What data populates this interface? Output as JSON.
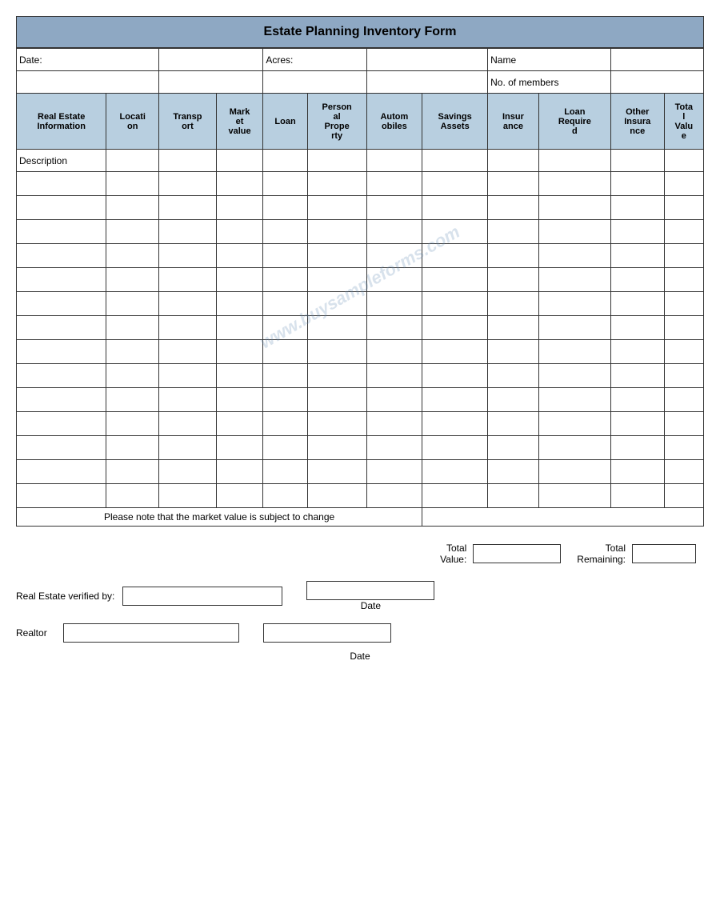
{
  "title": "Estate Planning Inventory Form",
  "topInfo": {
    "dateLabel": "Date:",
    "acresLabel": "Acres:",
    "nameLabel": "Name",
    "noOfMembersLabel": "No. of members"
  },
  "columns": [
    {
      "id": "real-estate",
      "label": "Real Estate\nInformation"
    },
    {
      "id": "location",
      "label": "Locati\non"
    },
    {
      "id": "transport",
      "label": "Transp\nort"
    },
    {
      "id": "market-value",
      "label": "Mark\net\nvalue"
    },
    {
      "id": "loan",
      "label": "Loan"
    },
    {
      "id": "personal-property",
      "label": "Person\nal\nPrope\nrty"
    },
    {
      "id": "automobiles",
      "label": "Autom\nobiles"
    },
    {
      "id": "savings-assets",
      "label": "Savings\nAssets"
    },
    {
      "id": "insurance",
      "label": "Insur\nance"
    },
    {
      "id": "loan-required",
      "label": "Loan\nRequire\nd"
    },
    {
      "id": "other-insurance",
      "label": "Other\nInsura\nnce"
    },
    {
      "id": "total-value",
      "label": "Tota\nl\nValu\ne"
    }
  ],
  "descriptionLabel": "Description",
  "dataRows": 14,
  "notice": "Please note that the market value is subject to change",
  "watermark": "www.buysampleforms.com",
  "bottomSection": {
    "totalValueLabel": "Total\nValue:",
    "totalRemainingLabel": "Total\nRemaining:",
    "realEstateVerifiedLabel": "Real Estate verified by:",
    "dateLabel": "Date",
    "realtorLabel": "Realtor",
    "bottomDateLabel": "Date"
  }
}
